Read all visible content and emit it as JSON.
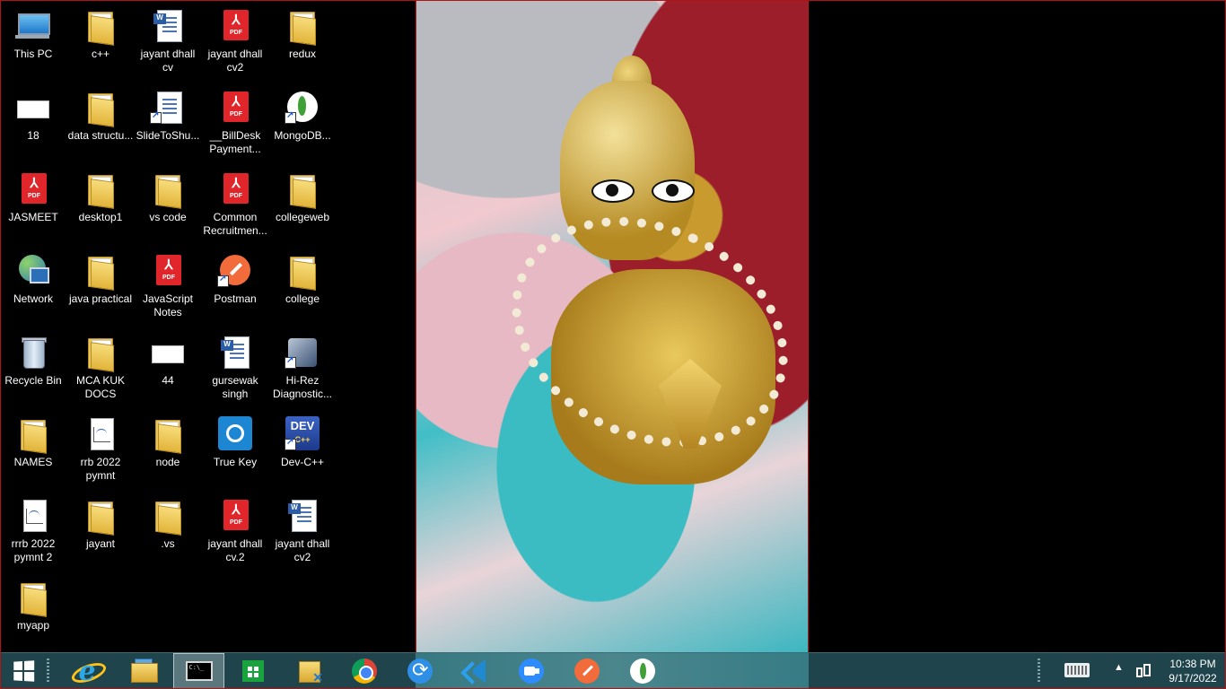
{
  "desktop": {
    "icons": [
      {
        "label": "This PC",
        "icon": "this-pc-icon"
      },
      {
        "label": "c++",
        "icon": "folder-icon"
      },
      {
        "label": "jayant dhall cv",
        "icon": "word-document-icon"
      },
      {
        "label": "jayant dhall cv2",
        "icon": "pdf-icon"
      },
      {
        "label": "redux",
        "icon": "folder-icon"
      },
      {
        "label": "18",
        "icon": "image-file-icon"
      },
      {
        "label": "data structu...",
        "icon": "folder-icon"
      },
      {
        "label": "SlideToShu...",
        "icon": "shortcut-icon"
      },
      {
        "label": "__BillDesk Payment...",
        "icon": "pdf-icon"
      },
      {
        "label": "MongoDB...",
        "icon": "mongodb-icon"
      },
      {
        "label": "JASMEET",
        "icon": "pdf-icon"
      },
      {
        "label": "desktop1",
        "icon": "folder-icon"
      },
      {
        "label": "vs code",
        "icon": "folder-icon"
      },
      {
        "label": "Common Recruitmen...",
        "icon": "pdf-icon"
      },
      {
        "label": "collegeweb",
        "icon": "folder-icon"
      },
      {
        "label": "Network",
        "icon": "network-icon"
      },
      {
        "label": "java practical",
        "icon": "folder-icon"
      },
      {
        "label": "JavaScript Notes",
        "icon": "pdf-icon"
      },
      {
        "label": "Postman",
        "icon": "postman-icon"
      },
      {
        "label": "college",
        "icon": "folder-icon"
      },
      {
        "label": "Recycle Bin",
        "icon": "recycle-bin-icon"
      },
      {
        "label": "MCA KUK DOCS",
        "icon": "folder-icon"
      },
      {
        "label": "44",
        "icon": "image-file-icon"
      },
      {
        "label": "gursewak singh",
        "icon": "word-document-icon"
      },
      {
        "label": "Hi-Rez Diagnostic...",
        "icon": "hi-rez-icon"
      },
      {
        "label": "NAMES",
        "icon": "folder-icon"
      },
      {
        "label": "rrb 2022 pymnt",
        "icon": "chart-file-icon"
      },
      {
        "label": "node",
        "icon": "folder-icon"
      },
      {
        "label": "True Key",
        "icon": "true-key-icon"
      },
      {
        "label": "Dev-C++",
        "icon": "dev-cpp-icon"
      },
      {
        "label": "rrrb 2022 pymnt 2",
        "icon": "chart-file-icon"
      },
      {
        "label": "jayant",
        "icon": "folder-icon"
      },
      {
        "label": ".vs",
        "icon": "folder-icon"
      },
      {
        "label": "jayant dhall cv.2",
        "icon": "pdf-icon"
      },
      {
        "label": "jayant dhall cv2",
        "icon": "word-document-icon"
      },
      {
        "label": "myapp",
        "icon": "folder-icon"
      }
    ]
  },
  "taskbar": {
    "apps": [
      {
        "name": "start-button",
        "icon": "windows-logo-icon"
      },
      {
        "name": "internet-explorer",
        "icon": "internet-explorer-icon"
      },
      {
        "name": "file-explorer",
        "icon": "file-explorer-icon"
      },
      {
        "name": "command-prompt",
        "icon": "command-prompt-icon",
        "active": true
      },
      {
        "name": "store",
        "icon": "store-icon"
      },
      {
        "name": "folder-app",
        "icon": "folder-app-icon"
      },
      {
        "name": "chrome",
        "icon": "chrome-icon"
      },
      {
        "name": "sync-app",
        "icon": "sync-icon"
      },
      {
        "name": "vscode",
        "icon": "vscode-icon"
      },
      {
        "name": "zoom",
        "icon": "zoom-icon"
      },
      {
        "name": "postman",
        "icon": "postman-icon"
      },
      {
        "name": "mongodb-compass",
        "icon": "mongodb-icon"
      }
    ],
    "tray": {
      "keyboard_icon": "touch-keyboard-icon",
      "overflow_icon": "chevron-up-icon",
      "network_icon": "network-status-icon",
      "time": "10:38 PM",
      "date": "9/17/2022"
    }
  },
  "colors": {
    "taskbar": "#224a52",
    "frame_border": "#c01818",
    "desktop_bg": "#000000"
  }
}
